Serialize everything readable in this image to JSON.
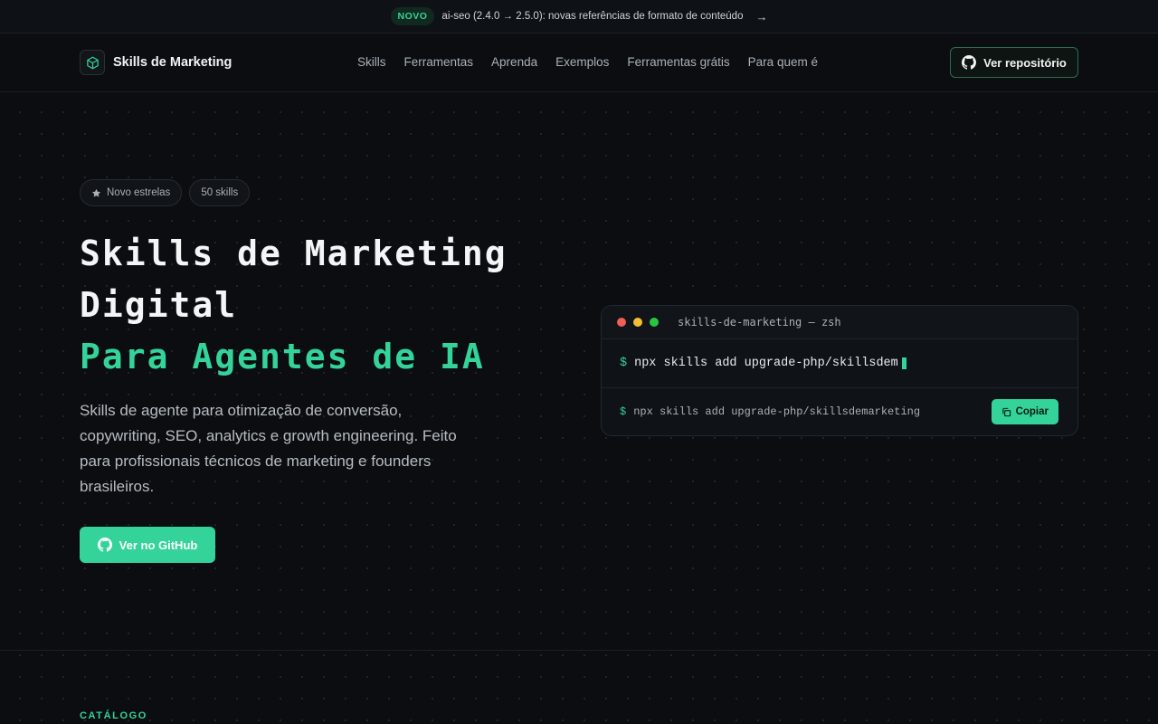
{
  "announcement": {
    "badge": "NOVO",
    "text": "ai-seo (2.4.0 → 2.5.0): novas referências de formato de conteúdo",
    "arrow": "→"
  },
  "navbar": {
    "brand": "Skills de Marketing",
    "brand_icon": "cube-icon",
    "links": [
      "Skills",
      "Ferramentas",
      "Aprenda",
      "Exemplos",
      "Ferramentas grátis",
      "Para quem é"
    ],
    "repo_button": "Ver repositório"
  },
  "hero": {
    "pills": [
      "Novo estrelas",
      "50 skills"
    ],
    "title_line1": "Skills de Marketing",
    "title_line2": "Digital",
    "title_line3": "Para Agentes de IA",
    "description": "Skills de agente para otimização de conversão, copywriting, SEO, analytics e growth engineering. Feito para profissionais técnicos de marketing e founders brasileiros.",
    "cta": "Ver no GitHub"
  },
  "terminal": {
    "title": "skills-de-marketing — zsh",
    "prompt": "$",
    "typed_command": "npx skills add upgrade-php/skillsdem",
    "full_command": "npx skills add upgrade-php/skillsdemarketing",
    "copy_button": "Copiar"
  },
  "catalog": {
    "label": "CATÁLOGO"
  },
  "colors": {
    "accent": "#34d399",
    "background": "#0b0d10",
    "dot_red": "#ef5f57",
    "dot_yellow": "#f5be30",
    "dot_green": "#27c840"
  }
}
